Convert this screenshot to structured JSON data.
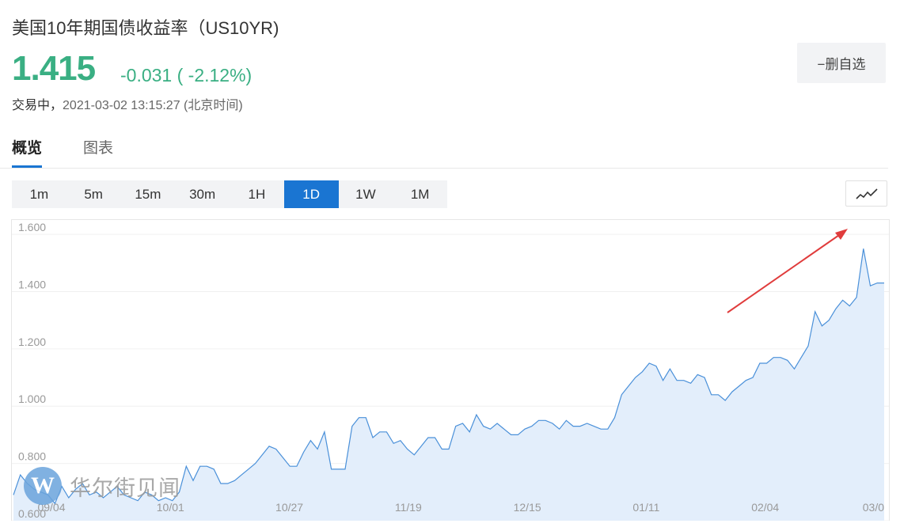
{
  "header": {
    "title": "美国10年期国债收益率（US10YR)",
    "price": "1.415",
    "change": "-0.031 ( -2.12%)",
    "status": "交易中，",
    "datetime": "2021-03-02 13:15:27 (北京时间)",
    "watchlist_button": "−删自选"
  },
  "tabs": [
    {
      "label": "概览",
      "active": true
    },
    {
      "label": "图表",
      "active": false
    }
  ],
  "periods": [
    {
      "label": "1m",
      "active": false
    },
    {
      "label": "5m",
      "active": false
    },
    {
      "label": "15m",
      "active": false
    },
    {
      "label": "30m",
      "active": false
    },
    {
      "label": "1H",
      "active": false
    },
    {
      "label": "1D",
      "active": true
    },
    {
      "label": "1W",
      "active": false
    },
    {
      "label": "1M",
      "active": false
    }
  ],
  "chart_type_icon": "line-chart-icon",
  "watermark": {
    "logo": "W",
    "text": "华尔街见闻"
  },
  "colors": {
    "up_green": "#3aaf83",
    "accent_blue": "#1a75d2",
    "line": "#4a90d9",
    "area": "#e3eefb",
    "arrow": "#e03c3c"
  },
  "chart_data": {
    "type": "area",
    "title": "",
    "ylim": [
      0.6,
      1.65
    ],
    "yticks": [
      "0.600",
      "0.800",
      "1.000",
      "1.200",
      "1.400",
      "1.600"
    ],
    "xticks": [
      "09/04",
      "10/01",
      "10/27",
      "11/19",
      "12/15",
      "01/11",
      "02/04",
      "03/0"
    ],
    "grid": true,
    "values": [
      0.69,
      0.76,
      0.73,
      0.71,
      0.7,
      0.69,
      0.66,
      0.72,
      0.68,
      0.71,
      0.73,
      0.69,
      0.7,
      0.68,
      0.7,
      0.72,
      0.69,
      0.68,
      0.67,
      0.7,
      0.69,
      0.67,
      0.68,
      0.67,
      0.7,
      0.79,
      0.74,
      0.79,
      0.79,
      0.78,
      0.73,
      0.73,
      0.74,
      0.76,
      0.78,
      0.8,
      0.83,
      0.86,
      0.85,
      0.82,
      0.79,
      0.79,
      0.84,
      0.88,
      0.85,
      0.91,
      0.78,
      0.78,
      0.78,
      0.93,
      0.96,
      0.96,
      0.89,
      0.91,
      0.91,
      0.87,
      0.88,
      0.85,
      0.83,
      0.86,
      0.89,
      0.89,
      0.85,
      0.85,
      0.93,
      0.94,
      0.91,
      0.97,
      0.93,
      0.92,
      0.94,
      0.92,
      0.9,
      0.9,
      0.92,
      0.93,
      0.95,
      0.95,
      0.94,
      0.92,
      0.95,
      0.93,
      0.93,
      0.94,
      0.93,
      0.92,
      0.92,
      0.96,
      1.04,
      1.07,
      1.1,
      1.12,
      1.15,
      1.14,
      1.09,
      1.13,
      1.09,
      1.09,
      1.08,
      1.11,
      1.1,
      1.04,
      1.04,
      1.02,
      1.05,
      1.07,
      1.09,
      1.1,
      1.15,
      1.15,
      1.17,
      1.17,
      1.16,
      1.13,
      1.17,
      1.21,
      1.33,
      1.28,
      1.3,
      1.34,
      1.37,
      1.35,
      1.38,
      1.55,
      1.42,
      1.43,
      1.43
    ],
    "annotation": "red arrow pointing up-right at latest rise"
  }
}
